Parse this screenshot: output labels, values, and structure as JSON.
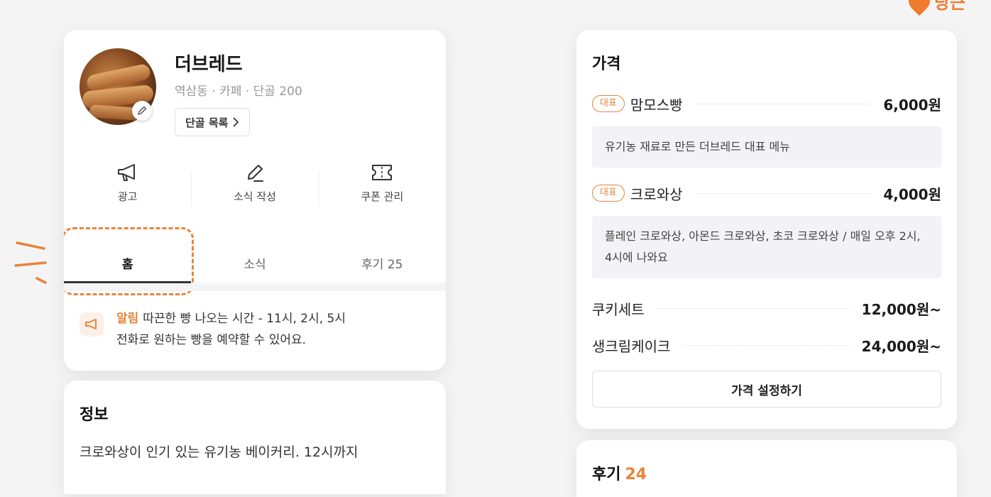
{
  "brand": {
    "text": "당근",
    "color": "#f07a2d"
  },
  "profile": {
    "name": "더브레드",
    "meta": "역삼동 · 카페 · 단골 200",
    "regulars_button": "단골 목록"
  },
  "actions": [
    {
      "label": "광고",
      "icon": "megaphone-icon"
    },
    {
      "label": "소식 작성",
      "icon": "pencil-icon"
    },
    {
      "label": "쿠폰 관리",
      "icon": "ticket-icon"
    }
  ],
  "tabs": [
    {
      "label": "홈",
      "active": true
    },
    {
      "label": "소식",
      "active": false
    },
    {
      "label": "후기 25",
      "active": false
    }
  ],
  "notice": {
    "tag": "알림",
    "line1": "따끈한 빵 나오는 시간 - 11시, 2시, 5시",
    "line2": "전화로 원하는 빵을 예약할 수 있어요."
  },
  "info": {
    "title": "정보",
    "description": "크로와상이 인기 있는 유기농 베이커리. 12시까지"
  },
  "price": {
    "title": "가격",
    "badge": "대표",
    "items": [
      {
        "name": "맘모스빵",
        "price": "6,000원",
        "desc": "유기농 재료로 만든 더브레드 대표 메뉴"
      },
      {
        "name": "크로와상",
        "price": "4,000원",
        "desc": "플레인 크로와상, 아몬드 크로와상, 초코 크로와상 / 매일 오후 2시, 4시에 나와요"
      },
      {
        "name": "쿠키세트",
        "price": "12,000원~"
      },
      {
        "name": "생크림케이크",
        "price": "24,000원~"
      }
    ],
    "button": "가격 설정하기"
  },
  "review": {
    "title": "후기",
    "count": "24"
  },
  "colors": {
    "accent": "#e8843a",
    "background": "#f4f4f4"
  }
}
